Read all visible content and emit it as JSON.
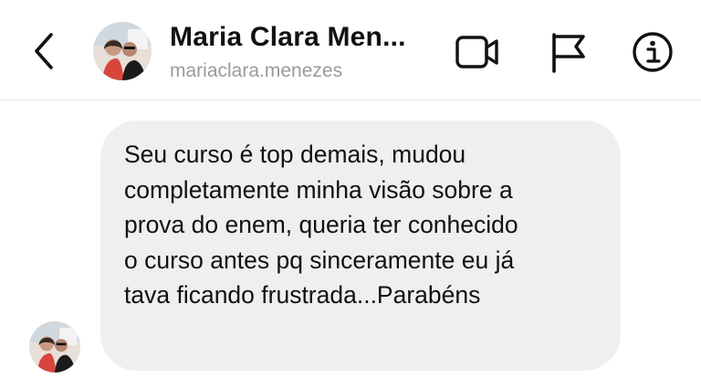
{
  "header": {
    "title": "Maria Clara Men...",
    "username": "mariaclara.menezes",
    "icons": {
      "back": "chevron-left-icon",
      "video": "video-camera-icon",
      "flag": "flag-icon",
      "info": "info-icon"
    }
  },
  "message": {
    "text": "Seu curso é top demais, mudou\ncompletamente minha visão sobre a\nprova do enem, queria ter conhecido\no curso antes pq sinceramente eu já\ntava ficando frustrada...Parabéns"
  },
  "colors": {
    "bubble": "#efefef",
    "text": "#111111",
    "subtitle": "#9a9a9a",
    "divider": "#e6e6e6"
  }
}
